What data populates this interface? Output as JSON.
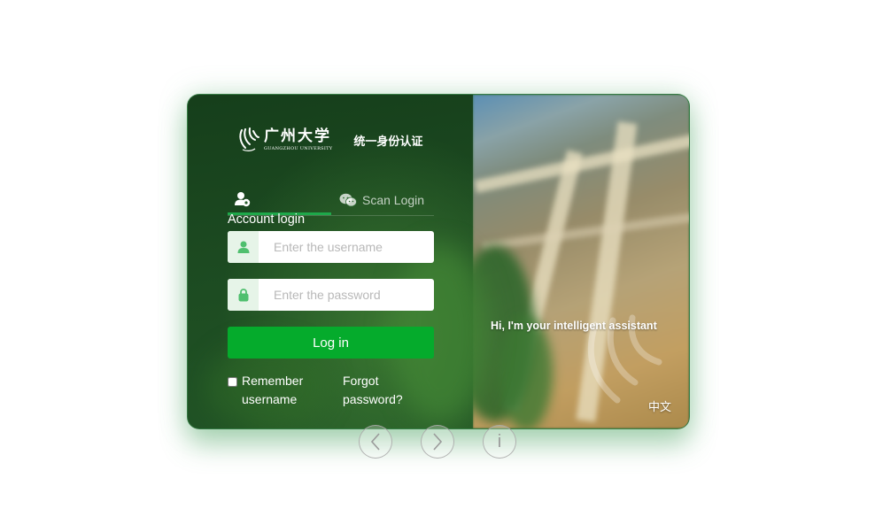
{
  "logo": {
    "name_cn": "广州大学",
    "name_en": "GUANGZHOU UNIVERSITY",
    "subtitle": "统一身份认证"
  },
  "tabs": {
    "account_label": "Account login",
    "scan_label": "Scan Login"
  },
  "form": {
    "username_placeholder": "Enter the username",
    "username_value": "",
    "password_placeholder": "Enter the password",
    "password_value": "",
    "login_label": "Log in",
    "remember_label": "Remember username",
    "remember_checked": false,
    "forgot_label": "Forgot password?"
  },
  "assistant_text": "Hi, I'm your intelligent assistant",
  "language_toggle": "中文",
  "icons": {
    "account_tab": "user-gear-icon",
    "scan_tab": "wechat-icon",
    "username": "user-icon",
    "password": "lock-icon",
    "prev": "chevron-left-icon",
    "next": "chevron-right-icon",
    "info": "info-icon"
  },
  "carousel": {
    "info_label": "i"
  },
  "colors": {
    "primary": "#05ab2c",
    "tab_indicator": "#1ea84a",
    "input_prefix_bg": "#e6f4e8",
    "icon_green": "#4fbf6e"
  }
}
